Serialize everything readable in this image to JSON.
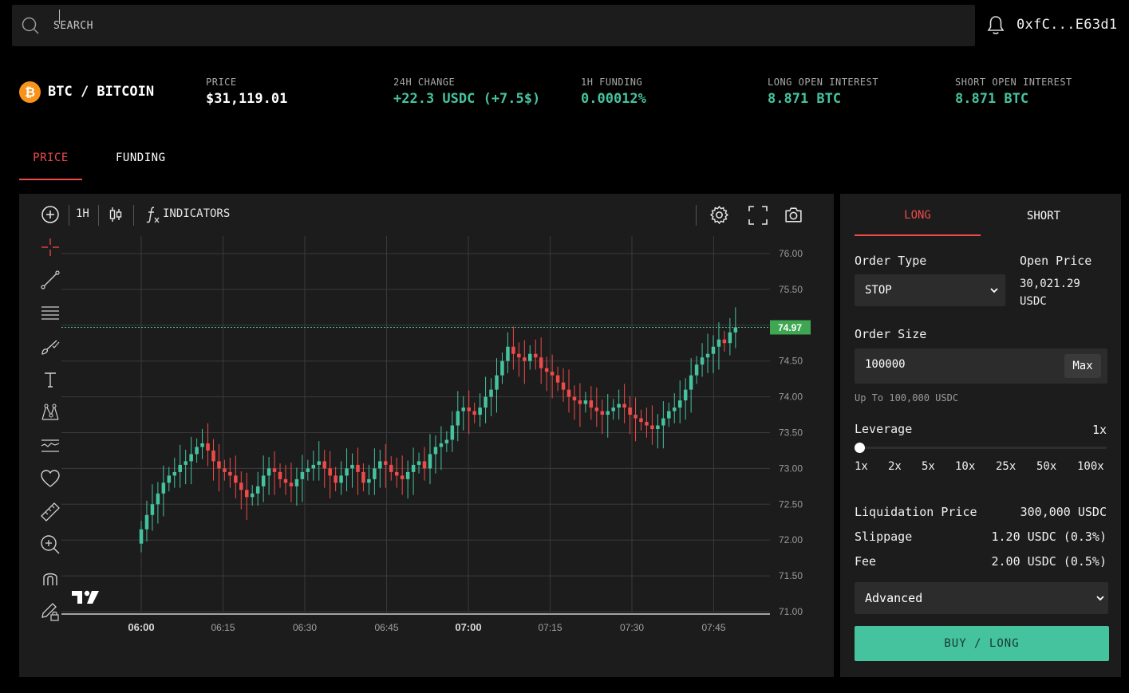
{
  "search": {
    "placeholder": "SEARCH"
  },
  "wallet": {
    "address": "0xfC...E63d1"
  },
  "market": {
    "coin_symbol": "₿",
    "pair": "BTC / BITCOIN",
    "stats": [
      {
        "label": "PRICE",
        "value": "$31,119.01"
      },
      {
        "label": "24H CHANGE",
        "value": "+22.3 USDC (+7.5$)"
      },
      {
        "label": "1H FUNDING",
        "value": "0.00012%"
      },
      {
        "label": "LONG OPEN INTEREST",
        "value": "8.871 BTC"
      },
      {
        "label": "SHORT OPEN INTEREST",
        "value": "8.871 BTC"
      }
    ]
  },
  "tabs": {
    "price": "PRICE",
    "funding": "FUNDING"
  },
  "chart_toolbar": {
    "interval": "1H",
    "indicators": "INDICATORS"
  },
  "colors": {
    "up": "#45c29e",
    "down": "#ef4a4a",
    "accent": "#ef4a4a",
    "panel": "#1c1c1c"
  },
  "chart_data": {
    "type": "candlestick",
    "current_price_label": "74.97",
    "current_price": 74.97,
    "ylim": [
      71.0,
      76.0
    ],
    "y_ticks": [
      "76.00",
      "75.50",
      "75.00",
      "74.50",
      "74.00",
      "73.50",
      "73.00",
      "72.50",
      "72.00",
      "71.50",
      "71.00"
    ],
    "x_ticks": [
      "06:00",
      "06:15",
      "06:30",
      "06:45",
      "07:00",
      "07:15",
      "07:30",
      "07:45"
    ],
    "x_tick_minutes": [
      0,
      15,
      30,
      45,
      60,
      75,
      90,
      105
    ],
    "series": [
      {
        "candles_close": [
          72.15,
          72.35,
          72.5,
          72.65,
          72.8,
          72.9,
          72.95,
          73.05,
          73.1,
          73.2,
          73.3,
          73.35,
          73.25,
          73.1,
          73.0,
          72.95,
          72.9,
          72.8,
          72.7,
          72.6,
          72.65,
          72.75,
          72.9,
          73.0,
          72.95,
          72.85,
          72.8,
          72.75,
          72.85,
          72.95,
          73.0,
          73.05,
          73.1,
          73.0,
          72.9,
          72.8,
          72.9,
          73.0,
          73.05,
          72.95,
          72.8,
          72.85,
          73.0,
          73.1,
          73.05,
          72.95,
          72.9,
          72.85,
          72.95,
          73.05,
          73.1,
          73.0,
          73.2,
          73.3,
          73.35,
          73.4,
          73.6,
          73.8,
          73.85,
          73.8,
          73.75,
          73.85,
          74.0,
          74.1,
          74.3,
          74.5,
          74.7,
          74.6,
          74.55,
          74.5,
          74.6,
          74.55,
          74.4,
          74.35,
          74.3,
          74.2,
          74.1,
          74.0,
          73.95,
          73.9,
          73.95,
          73.85,
          73.8,
          73.75,
          73.8,
          73.85,
          73.9,
          73.85,
          73.75,
          73.7,
          73.65,
          73.6,
          73.55,
          73.6,
          73.7,
          73.8,
          73.85,
          73.95,
          74.1,
          74.3,
          74.45,
          74.55,
          74.6,
          74.7,
          74.8,
          74.75,
          74.9,
          74.97
        ],
        "candles_open": [
          71.95,
          72.15,
          72.35,
          72.5,
          72.65,
          72.8,
          72.9,
          72.95,
          73.05,
          73.1,
          73.2,
          73.3,
          73.35,
          73.25,
          73.1,
          73.0,
          72.95,
          72.9,
          72.8,
          72.7,
          72.6,
          72.65,
          72.75,
          72.9,
          73.0,
          72.95,
          72.85,
          72.8,
          72.75,
          72.85,
          72.95,
          73.0,
          73.05,
          73.1,
          73.0,
          72.9,
          72.8,
          72.9,
          73.0,
          73.05,
          72.95,
          72.8,
          72.85,
          73.0,
          73.1,
          73.05,
          72.95,
          72.9,
          72.85,
          72.95,
          73.05,
          73.1,
          73.0,
          73.2,
          73.3,
          73.35,
          73.4,
          73.6,
          73.8,
          73.85,
          73.8,
          73.75,
          73.85,
          74.0,
          74.1,
          74.3,
          74.5,
          74.7,
          74.6,
          74.55,
          74.5,
          74.6,
          74.55,
          74.4,
          74.35,
          74.3,
          74.2,
          74.1,
          74.0,
          73.95,
          73.9,
          73.95,
          73.85,
          73.8,
          73.75,
          73.8,
          73.85,
          73.9,
          73.85,
          73.75,
          73.7,
          73.65,
          73.6,
          73.55,
          73.6,
          73.7,
          73.8,
          73.85,
          73.95,
          74.1,
          74.3,
          74.45,
          74.55,
          74.6,
          74.7,
          74.8,
          74.75,
          74.9
        ]
      }
    ]
  },
  "order": {
    "tab_long": "LONG",
    "tab_short": "SHORT",
    "order_type_label": "Order Type",
    "order_type_value": "STOP",
    "open_price_label": "Open Price",
    "open_price_value": "30,021.29",
    "open_price_unit": "USDC",
    "order_size_label": "Order Size",
    "order_size_value": "100000",
    "max_label": "Max",
    "size_hint": "Up To 100,000 USDC",
    "leverage_label": "Leverage",
    "leverage_value": "1x",
    "leverage_level": 0,
    "leverage_options": [
      "1x",
      "2x",
      "5x",
      "10x",
      "25x",
      "50x",
      "100x"
    ],
    "liq_label": "Liquidation Price",
    "liq_value": "300,000 USDC",
    "slippage_label": "Slippage",
    "slippage_value": "1.20 USDC (0.3%)",
    "fee_label": "Fee",
    "fee_value": "2.00 USDC (0.5%)",
    "advanced_value": "Advanced",
    "buy_label": "BUY / LONG"
  }
}
